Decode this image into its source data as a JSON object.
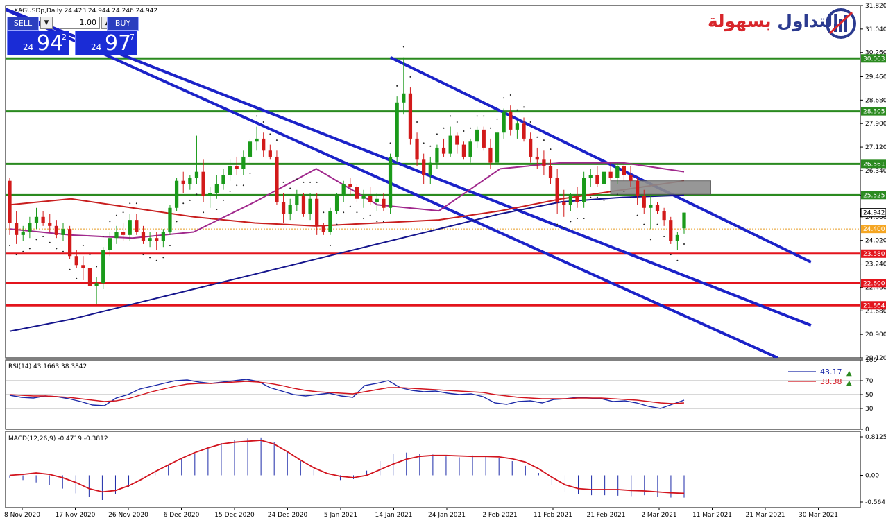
{
  "chart_title": "XAGUSDp,Daily  24.423 24.944 24.246 24.942",
  "trade_panel": {
    "sell_label": "SELL",
    "buy_label": "BUY",
    "lot": "1.00",
    "sell_price_small": "24",
    "sell_price_big": "94",
    "sell_price_sup": "2",
    "buy_price_small": "24",
    "buy_price_big": "97",
    "buy_price_sup": "7",
    "qty_down_icon": "dropdown-arrow-icon",
    "qty_up_icon": "up-arrow-icon"
  },
  "logo": {
    "text_red": "بسهولة",
    "text_blue": "التداول",
    "icon": "bar-chart-logo-icon"
  },
  "colors": {
    "bull": "#1a9a1a",
    "bear": "#d21a1a",
    "resistance": "#2a8a1f",
    "support": "#e3141c",
    "channel": "#1b22c8",
    "ma_long": "#14148c",
    "ma_mid": "#c81e1e",
    "ma_short": "#a0288c",
    "rsi_line": "#1c2aa8",
    "rsi_signal": "#d2141e",
    "macd_signal": "#d2141e"
  },
  "chart_data": {
    "type": "candlestick",
    "symbol": "XAGUSDp",
    "timeframe": "Daily",
    "ohlc_header": {
      "open": 24.423,
      "high": 24.944,
      "low": 24.246,
      "close": 24.942
    },
    "price_axis_ticks": [
      "31.820",
      "31.040",
      "30.260",
      "29.460",
      "28.680",
      "27.900",
      "27.120",
      "26.340",
      "25.525",
      "24.800",
      "24.020",
      "23.240",
      "22.460",
      "21.680",
      "20.900",
      "20.120"
    ],
    "date_axis_ticks": [
      "8 Nov 2020",
      "17 Nov 2020",
      "26 Nov 2020",
      "6 Dec 2020",
      "15 Dec 2020",
      "24 Dec 2020",
      "5 Jan 2021",
      "14 Jan 2021",
      "24 Jan 2021",
      "2 Feb 2021",
      "11 Feb 2021",
      "21 Feb 2021",
      "2 Mar 2021",
      "11 Mar 2021",
      "21 Mar 2021",
      "30 Mar 2021"
    ],
    "ylim": [
      20.12,
      31.82
    ],
    "horizontal_levels": [
      {
        "price": 30.063,
        "label": "30.063",
        "role": "resistance"
      },
      {
        "price": 28.305,
        "label": "28.305",
        "role": "resistance"
      },
      {
        "price": 26.561,
        "label": "26.561",
        "role": "resistance"
      },
      {
        "price": 25.525,
        "label": "25.525",
        "role": "resistance"
      },
      {
        "price": 24.4,
        "label": "24.400",
        "role": "ask-line"
      },
      {
        "price": 23.58,
        "label": "23.580",
        "role": "support"
      },
      {
        "price": 22.6,
        "label": "22.600",
        "role": "support"
      },
      {
        "price": 21.864,
        "label": "21.864",
        "role": "support"
      }
    ],
    "current_price_label": "24.942",
    "candles": [
      [
        26.0,
        26.1,
        24.2,
        24.6
      ],
      [
        24.6,
        25.0,
        23.9,
        24.2
      ],
      [
        24.2,
        24.5,
        24.0,
        24.3
      ],
      [
        24.3,
        24.8,
        24.1,
        24.6
      ],
      [
        24.6,
        25.1,
        24.4,
        24.8
      ],
      [
        24.8,
        25.0,
        24.5,
        24.6
      ],
      [
        24.6,
        24.9,
        24.3,
        24.5
      ],
      [
        24.5,
        24.7,
        24.1,
        24.2
      ],
      [
        24.2,
        24.6,
        24.0,
        24.4
      ],
      [
        24.4,
        24.5,
        23.4,
        23.5
      ],
      [
        23.5,
        23.7,
        23.1,
        23.2
      ],
      [
        23.2,
        23.5,
        22.7,
        23.1
      ],
      [
        23.1,
        23.2,
        22.3,
        22.5
      ],
      [
        22.5,
        22.8,
        21.9,
        22.6
      ],
      [
        22.6,
        23.8,
        22.4,
        23.7
      ],
      [
        23.7,
        24.3,
        23.5,
        24.1
      ],
      [
        24.1,
        24.5,
        23.9,
        24.3
      ],
      [
        24.3,
        24.6,
        24.0,
        24.2
      ],
      [
        24.2,
        24.9,
        24.0,
        24.7
      ],
      [
        24.7,
        24.9,
        24.2,
        24.3
      ],
      [
        24.3,
        24.5,
        23.9,
        24.0
      ],
      [
        24.0,
        24.3,
        23.8,
        24.1
      ],
      [
        24.1,
        24.3,
        23.7,
        24.0
      ],
      [
        24.0,
        24.4,
        23.8,
        24.3
      ],
      [
        24.3,
        25.2,
        24.2,
        25.1
      ],
      [
        25.1,
        26.1,
        25.0,
        26.0
      ],
      [
        26.0,
        26.3,
        25.6,
        25.9
      ],
      [
        25.9,
        26.2,
        25.7,
        26.1
      ],
      [
        26.1,
        27.5,
        25.9,
        26.3
      ],
      [
        26.3,
        26.7,
        25.3,
        25.5
      ],
      [
        25.5,
        25.8,
        25.1,
        25.6
      ],
      [
        25.6,
        26.2,
        25.4,
        25.9
      ],
      [
        25.9,
        26.4,
        25.7,
        26.2
      ],
      [
        26.2,
        26.7,
        26.0,
        26.5
      ],
      [
        26.5,
        26.8,
        26.2,
        26.4
      ],
      [
        26.4,
        27.0,
        26.2,
        26.8
      ],
      [
        26.8,
        27.4,
        26.6,
        27.3
      ],
      [
        27.3,
        27.8,
        27.0,
        27.4
      ],
      [
        27.4,
        27.6,
        26.8,
        27.0
      ],
      [
        27.0,
        27.2,
        26.7,
        26.8
      ],
      [
        26.8,
        27.0,
        25.2,
        25.3
      ],
      [
        25.3,
        25.6,
        24.6,
        24.9
      ],
      [
        24.9,
        25.4,
        24.7,
        25.2
      ],
      [
        25.2,
        25.7,
        25.0,
        25.5
      ],
      [
        25.5,
        25.6,
        24.8,
        24.9
      ],
      [
        24.9,
        25.6,
        24.7,
        25.4
      ],
      [
        25.4,
        25.6,
        24.2,
        24.5
      ],
      [
        24.5,
        24.6,
        24.2,
        24.3
      ],
      [
        24.3,
        25.1,
        24.2,
        25.0
      ],
      [
        25.0,
        25.6,
        24.9,
        25.5
      ],
      [
        25.5,
        26.0,
        25.3,
        25.9
      ],
      [
        25.9,
        26.1,
        25.5,
        25.8
      ],
      [
        25.8,
        25.9,
        25.3,
        25.4
      ],
      [
        25.4,
        25.7,
        25.1,
        25.5
      ],
      [
        25.5,
        25.8,
        25.2,
        25.3
      ],
      [
        25.3,
        25.6,
        25.0,
        25.4
      ],
      [
        25.4,
        25.6,
        25.0,
        25.1
      ],
      [
        25.1,
        26.9,
        24.9,
        26.8
      ],
      [
        26.8,
        28.8,
        26.6,
        28.6
      ],
      [
        28.6,
        30.1,
        28.2,
        28.9
      ],
      [
        28.9,
        29.1,
        27.2,
        27.4
      ],
      [
        27.4,
        27.6,
        26.5,
        26.7
      ],
      [
        26.7,
        26.9,
        25.9,
        26.2
      ],
      [
        26.2,
        26.8,
        25.9,
        26.6
      ],
      [
        26.6,
        27.2,
        26.4,
        27.1
      ],
      [
        27.1,
        27.4,
        26.8,
        26.9
      ],
      [
        26.9,
        27.8,
        26.8,
        27.5
      ],
      [
        27.5,
        27.6,
        26.9,
        27.2
      ],
      [
        27.2,
        27.3,
        26.7,
        26.8
      ],
      [
        26.8,
        27.4,
        26.6,
        27.3
      ],
      [
        27.3,
        27.8,
        27.1,
        27.7
      ],
      [
        27.7,
        27.8,
        27.0,
        27.1
      ],
      [
        27.1,
        27.4,
        26.4,
        26.6
      ],
      [
        26.6,
        27.7,
        26.5,
        27.6
      ],
      [
        27.6,
        28.4,
        27.4,
        28.3
      ],
      [
        28.3,
        28.5,
        27.5,
        27.7
      ],
      [
        27.7,
        28.0,
        27.4,
        27.9
      ],
      [
        27.9,
        28.1,
        27.3,
        27.4
      ],
      [
        27.4,
        27.6,
        26.6,
        26.8
      ],
      [
        26.8,
        27.1,
        26.4,
        26.7
      ],
      [
        26.7,
        27.0,
        26.2,
        26.5
      ],
      [
        26.5,
        26.7,
        25.9,
        26.1
      ],
      [
        26.1,
        26.4,
        24.9,
        25.3
      ],
      [
        25.3,
        25.7,
        24.8,
        25.2
      ],
      [
        25.2,
        25.6,
        25.0,
        25.5
      ],
      [
        25.5,
        25.8,
        25.1,
        25.3
      ],
      [
        25.3,
        26.3,
        25.1,
        26.1
      ],
      [
        26.1,
        26.4,
        25.8,
        26.2
      ],
      [
        26.2,
        26.5,
        25.8,
        25.9
      ],
      [
        25.9,
        26.4,
        25.7,
        26.3
      ],
      [
        26.3,
        26.6,
        26.0,
        26.1
      ],
      [
        26.1,
        26.6,
        25.9,
        26.5
      ],
      [
        26.5,
        26.6,
        26.0,
        26.2
      ],
      [
        26.2,
        26.5,
        25.8,
        26.0
      ],
      [
        26.0,
        26.1,
        25.2,
        25.5
      ],
      [
        25.5,
        25.7,
        24.9,
        25.1
      ],
      [
        25.1,
        25.5,
        24.4,
        25.2
      ],
      [
        25.2,
        25.3,
        24.9,
        25.0
      ],
      [
        25.0,
        25.1,
        24.5,
        24.7
      ],
      [
        24.7,
        24.8,
        23.9,
        24.0
      ],
      [
        24.0,
        24.3,
        23.7,
        24.2
      ],
      [
        24.423,
        24.944,
        24.246,
        24.942
      ]
    ],
    "moving_averages": {
      "ma_long": [
        21.0,
        21.4,
        21.9,
        22.4,
        22.9,
        23.4,
        23.9,
        24.4,
        24.9,
        25.3,
        25.45,
        25.52
      ],
      "ma_mid": [
        25.2,
        25.4,
        25.1,
        24.8,
        24.6,
        24.5,
        24.6,
        24.7,
        25.0,
        25.4,
        25.7,
        26.0
      ],
      "ma_short": [
        24.4,
        24.2,
        24.1,
        24.3,
        25.3,
        26.4,
        25.2,
        25.0,
        26.4,
        26.6,
        26.6,
        26.3
      ]
    },
    "rsi": {
      "title": "RSI(14) 43.1663 38.3842",
      "value_label": "43.17",
      "signal_label": "38.38",
      "ticks": [
        "100",
        "70",
        "50",
        "30",
        "0"
      ],
      "levels": [
        70,
        50,
        30
      ],
      "values": [
        49,
        46,
        45,
        48,
        47,
        44,
        40,
        35,
        34,
        45,
        50,
        58,
        62,
        66,
        70,
        71,
        68,
        66,
        68,
        70,
        72,
        69,
        60,
        55,
        50,
        48,
        50,
        52,
        48,
        46,
        63,
        66,
        70,
        60,
        56,
        54,
        55,
        52,
        50,
        51,
        47,
        38,
        36,
        40,
        41,
        38,
        43,
        44,
        46,
        45,
        44,
        40,
        41,
        38,
        33,
        30,
        36,
        42
      ],
      "signal": [
        50,
        49,
        48,
        48,
        47,
        46,
        44,
        42,
        40,
        41,
        44,
        49,
        54,
        58,
        62,
        65,
        66,
        66,
        67,
        68,
        69,
        68,
        66,
        63,
        59,
        56,
        54,
        53,
        52,
        51,
        54,
        57,
        60,
        60,
        59,
        58,
        57,
        56,
        55,
        54,
        53,
        50,
        48,
        46,
        45,
        44,
        44,
        44,
        45,
        45,
        45,
        44,
        43,
        42,
        40,
        38,
        37,
        38
      ]
    },
    "macd": {
      "title": "MACD(12,26,9) -0.4719 -0.3812",
      "ticks": [
        "0.8125",
        "0.00",
        "-0.5641"
      ],
      "ylim": [
        -0.5641,
        0.8125
      ],
      "histogram": [
        -0.05,
        -0.1,
        -0.15,
        -0.2,
        -0.28,
        -0.38,
        -0.45,
        -0.52,
        -0.4,
        -0.25,
        -0.08,
        0.08,
        0.22,
        0.35,
        0.46,
        0.58,
        0.68,
        0.74,
        0.78,
        0.8,
        0.7,
        0.5,
        0.3,
        0.12,
        0.0,
        -0.1,
        -0.08,
        0.1,
        0.3,
        0.45,
        0.48,
        0.46,
        0.44,
        0.4,
        0.38,
        0.42,
        0.4,
        0.36,
        0.3,
        0.2,
        0.05,
        -0.2,
        -0.35,
        -0.4,
        -0.42,
        -0.42,
        -0.43,
        -0.44,
        -0.42,
        -0.45,
        -0.47,
        -0.47
      ],
      "signal": [
        0.0,
        0.02,
        0.05,
        0.02,
        -0.05,
        -0.15,
        -0.28,
        -0.35,
        -0.32,
        -0.22,
        -0.08,
        0.08,
        0.22,
        0.36,
        0.48,
        0.58,
        0.66,
        0.7,
        0.72,
        0.74,
        0.66,
        0.5,
        0.32,
        0.16,
        0.04,
        -0.02,
        -0.05,
        0.0,
        0.12,
        0.24,
        0.34,
        0.4,
        0.42,
        0.42,
        0.41,
        0.4,
        0.4,
        0.39,
        0.35,
        0.28,
        0.14,
        -0.04,
        -0.2,
        -0.28,
        -0.3,
        -0.3,
        -0.3,
        -0.32,
        -0.33,
        -0.35,
        -0.37,
        -0.38
      ]
    }
  }
}
